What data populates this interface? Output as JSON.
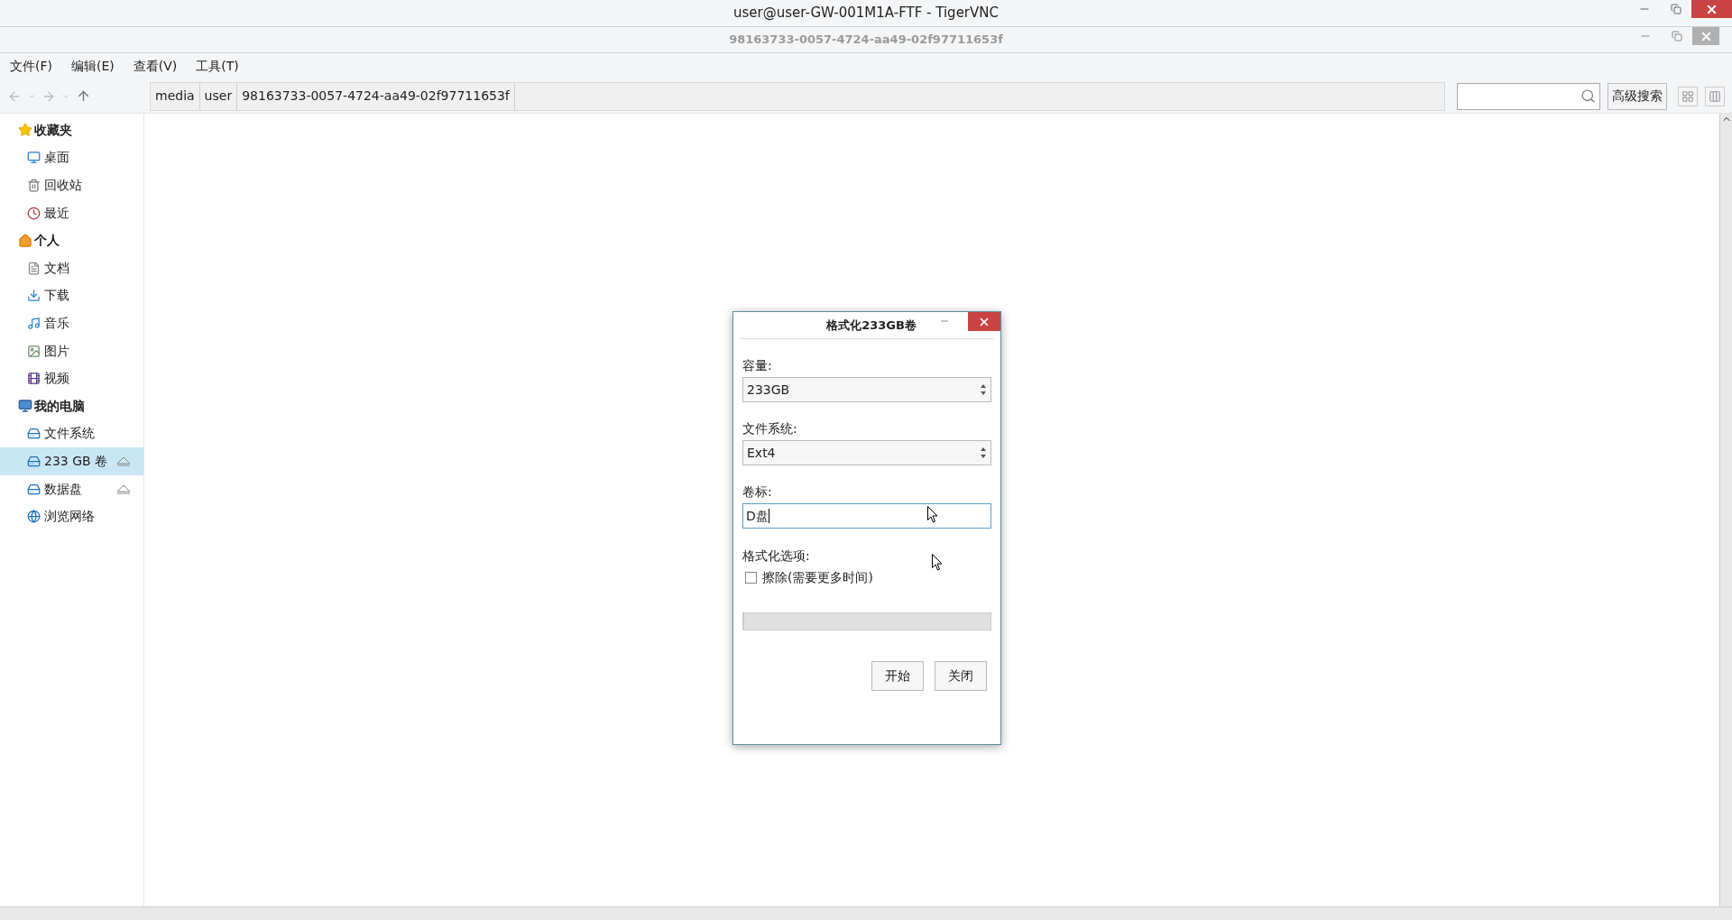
{
  "window": {
    "title": "user@user-GW-001M1A-FTF - TigerVNC"
  },
  "inner_window": {
    "title": "98163733-0057-4724-aa49-02f97711653f"
  },
  "menu": [
    "文件(F)",
    "编辑(E)",
    "查看(V)",
    "工具(T)"
  ],
  "breadcrumb": [
    "media",
    "user",
    "98163733-0057-4724-aa49-02f97711653f"
  ],
  "advanced_search_button": "高级搜索",
  "sidebar": [
    {
      "title": "收藏夹",
      "children": [
        {
          "label": "桌面",
          "selected": false,
          "ejectable": false
        },
        {
          "label": "回收站",
          "selected": false,
          "ejectable": false
        },
        {
          "label": "最近",
          "selected": false,
          "ejectable": false
        }
      ]
    },
    {
      "title": "个人",
      "children": [
        {
          "label": "文档",
          "selected": false,
          "ejectable": false
        },
        {
          "label": "下载",
          "selected": false,
          "ejectable": false
        },
        {
          "label": "音乐",
          "selected": false,
          "ejectable": false
        },
        {
          "label": "图片",
          "selected": false,
          "ejectable": false
        },
        {
          "label": "视频",
          "selected": false,
          "ejectable": false
        }
      ]
    },
    {
      "title": "我的电脑",
      "children": [
        {
          "label": "文件系统",
          "selected": false,
          "ejectable": false
        },
        {
          "label": "233 GB 卷",
          "selected": true,
          "ejectable": true
        },
        {
          "label": "数据盘",
          "selected": false,
          "ejectable": true
        },
        {
          "label": "浏览网络",
          "selected": false,
          "ejectable": false
        }
      ]
    }
  ],
  "dialog": {
    "title": "格式化233GB卷",
    "fields": [
      {
        "kind": "select",
        "label": "容量:",
        "value": "233GB"
      },
      {
        "kind": "select",
        "label": "文件系统:",
        "value": "Ext4"
      },
      {
        "kind": "text",
        "label": "卷标:",
        "value": "D盘"
      }
    ],
    "options_label": "格式化选项:",
    "erase_option": {
      "label": "擦除(需要更多时间)",
      "checked": false
    },
    "progress": {
      "level": 0
    },
    "buttons": [
      "开始",
      "关闭"
    ]
  }
}
